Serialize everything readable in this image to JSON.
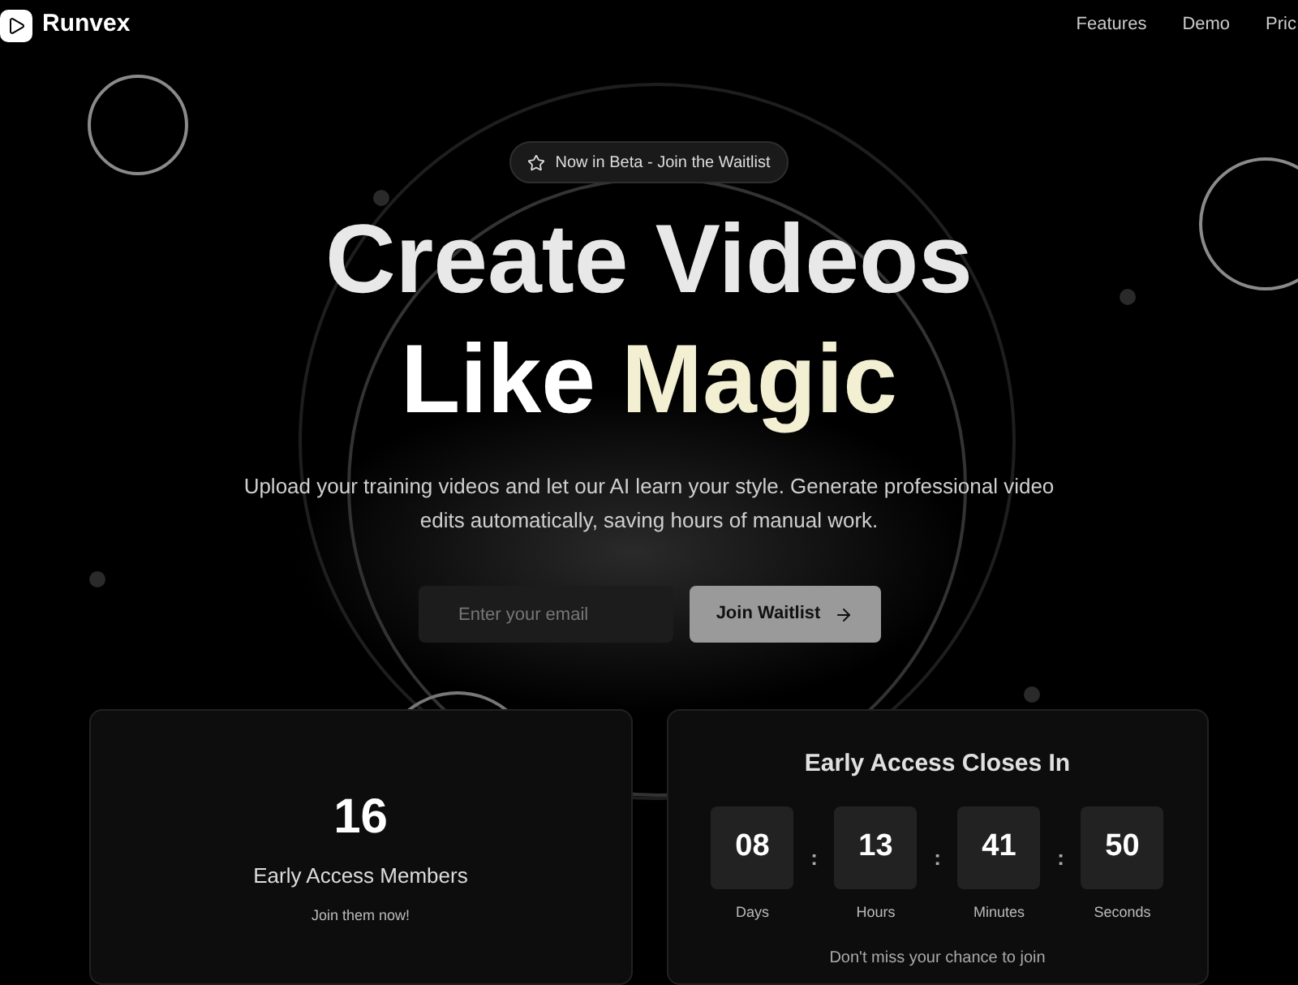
{
  "brand": {
    "name": "Runvex"
  },
  "nav": [
    "Features",
    "Demo",
    "Pric"
  ],
  "badge": {
    "label": "Now in Beta - Join the Waitlist"
  },
  "headline": {
    "line1": "Create Videos",
    "line2_plain": "Like",
    "line2_accent": "Magic"
  },
  "subtitle": "Upload your training videos and let our AI learn your style. Generate professional video edits automatically, saving hours of manual work.",
  "signup": {
    "placeholder": "Enter your email",
    "button": "Join Waitlist"
  },
  "members": {
    "count": "16",
    "label": "Early Access Members",
    "note": "Join them now!"
  },
  "countdown": {
    "title": "Early Access Closes In",
    "separator": ":",
    "units": [
      {
        "value": "08",
        "label": "Days"
      },
      {
        "value": "13",
        "label": "Hours"
      },
      {
        "value": "41",
        "label": "Minutes"
      },
      {
        "value": "50",
        "label": "Seconds"
      }
    ],
    "note": "Don't miss your chance to join"
  }
}
